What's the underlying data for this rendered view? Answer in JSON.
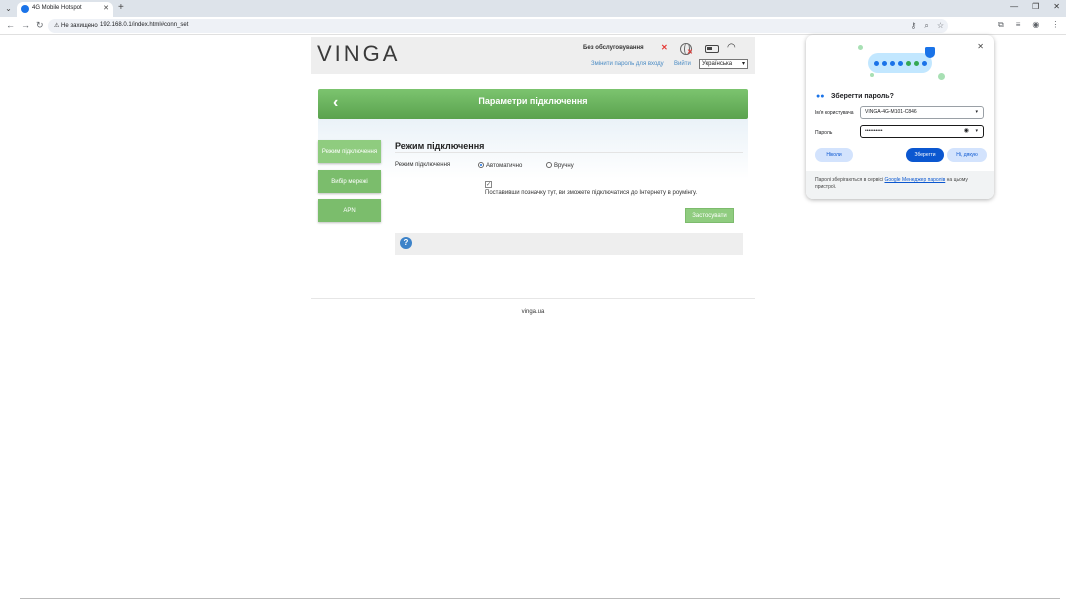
{
  "browser": {
    "tab_title": "4G Mobile Hotspot",
    "security_label": "Не захищено",
    "url": "192.168.0.1/index.html#conn_set",
    "tab_close": "✕",
    "new_tab": "+",
    "minimize": "—",
    "restore": "❐",
    "close": "✕"
  },
  "header": {
    "logo": "VINGA",
    "status": "Без обслуговування",
    "change_password": "Змінити пароль для входу",
    "logout": "Вийти",
    "language": "Українська"
  },
  "panel": {
    "title": "Параметри підключення",
    "back": "‹"
  },
  "sidebar": {
    "items": [
      {
        "label": "Режим підключення"
      },
      {
        "label": "Вибір мережі"
      },
      {
        "label": "APN"
      }
    ]
  },
  "content": {
    "section_title": "Режим підключення",
    "field_label": "Режим підключення",
    "radio_auto": "Автоматично",
    "radio_manual": "Вручну",
    "roaming_note": "Поставивши позначку тут, ви зможете підключатися до Інтернету в роумінгу.",
    "apply": "Застосувати",
    "help": "?"
  },
  "footer": {
    "text": "vinga.ua"
  },
  "popup": {
    "title": "Зберегти пароль?",
    "username_label": "Ім'я користувача",
    "username_value": "VINGA-4G-M101-C846",
    "password_label": "Пароль",
    "password_value": "••••••••••",
    "never": "Ніколи",
    "save": "Зберегти",
    "no_thanks": "Ні, дякую",
    "footer_prefix": "Паролі зберігаються в сервісі",
    "footer_link": "Google Менеджер паролів",
    "footer_suffix": "на цьому пристрої.",
    "close": "✕"
  },
  "colors": {
    "accent_green": "#7bbd6c",
    "link_blue": "#4a8bc4",
    "chrome_blue": "#0b57d0"
  }
}
